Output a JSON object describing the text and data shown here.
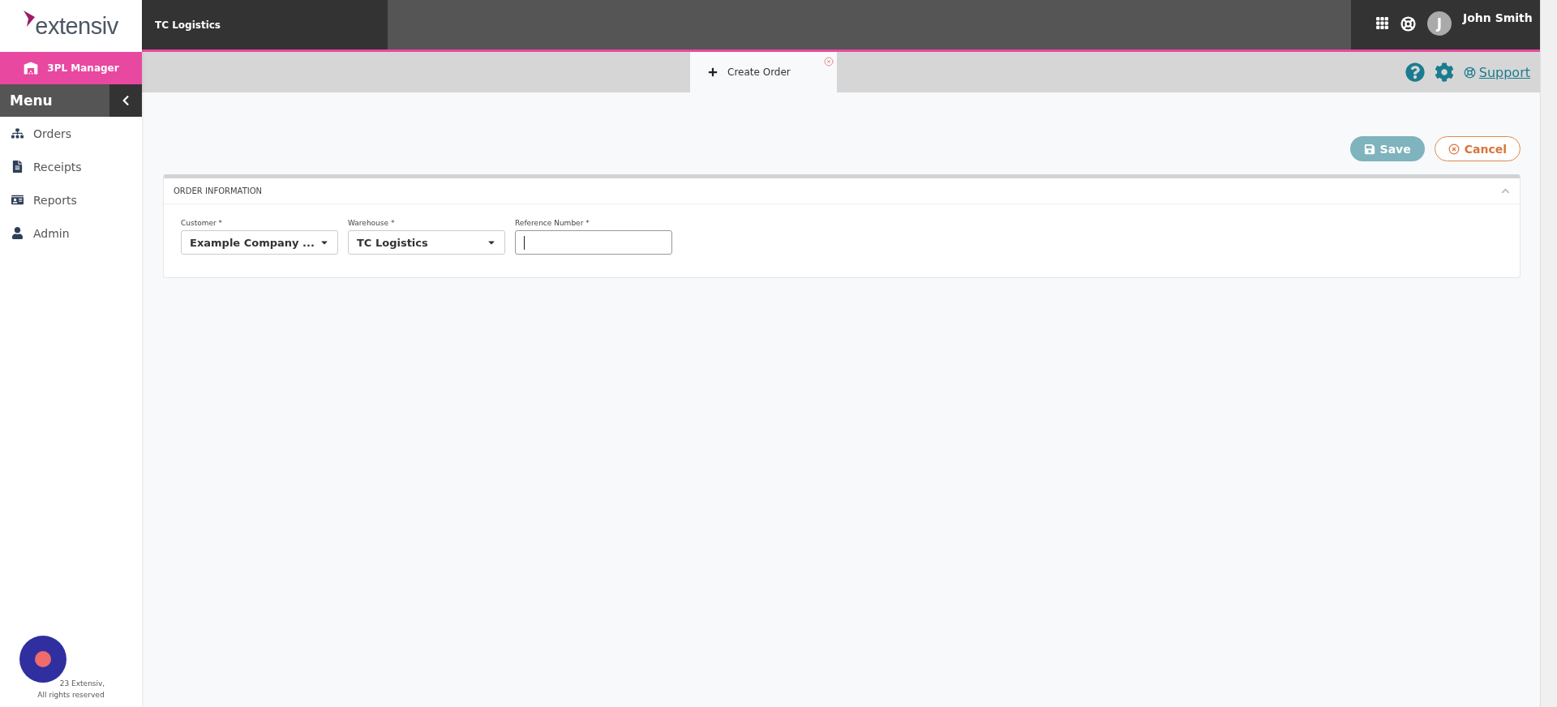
{
  "brand": {
    "logo": "extensiv",
    "module": "3PL Manager"
  },
  "top_bar": {
    "title": "TC Logistics",
    "user": {
      "initial": "J",
      "name": "John Smith"
    }
  },
  "sidebar": {
    "heading": "Menu",
    "items": [
      {
        "label": "Orders"
      },
      {
        "label": "Receipts"
      },
      {
        "label": "Reports"
      },
      {
        "label": "Admin"
      }
    ],
    "footer": [
      "23 Extensiv,",
      "All rights reserved"
    ]
  },
  "tabs": [
    {
      "label": "Create Order",
      "selected": true
    }
  ],
  "support_link": "Support",
  "actions": [
    {
      "label": "Save",
      "kind": "save",
      "disabled": true
    },
    {
      "label": "Cancel",
      "kind": "cancel",
      "disabled": false
    }
  ],
  "section": {
    "title": "ORDER INFORMATION",
    "expanded": true,
    "fields": [
      {
        "label": "Customer *",
        "kind": "select",
        "value": "Example Company ..."
      },
      {
        "label": "Warehouse *",
        "kind": "select",
        "value": "TC Logistics"
      },
      {
        "label": "Reference Number *",
        "kind": "text",
        "focused": true
      }
    ]
  }
}
